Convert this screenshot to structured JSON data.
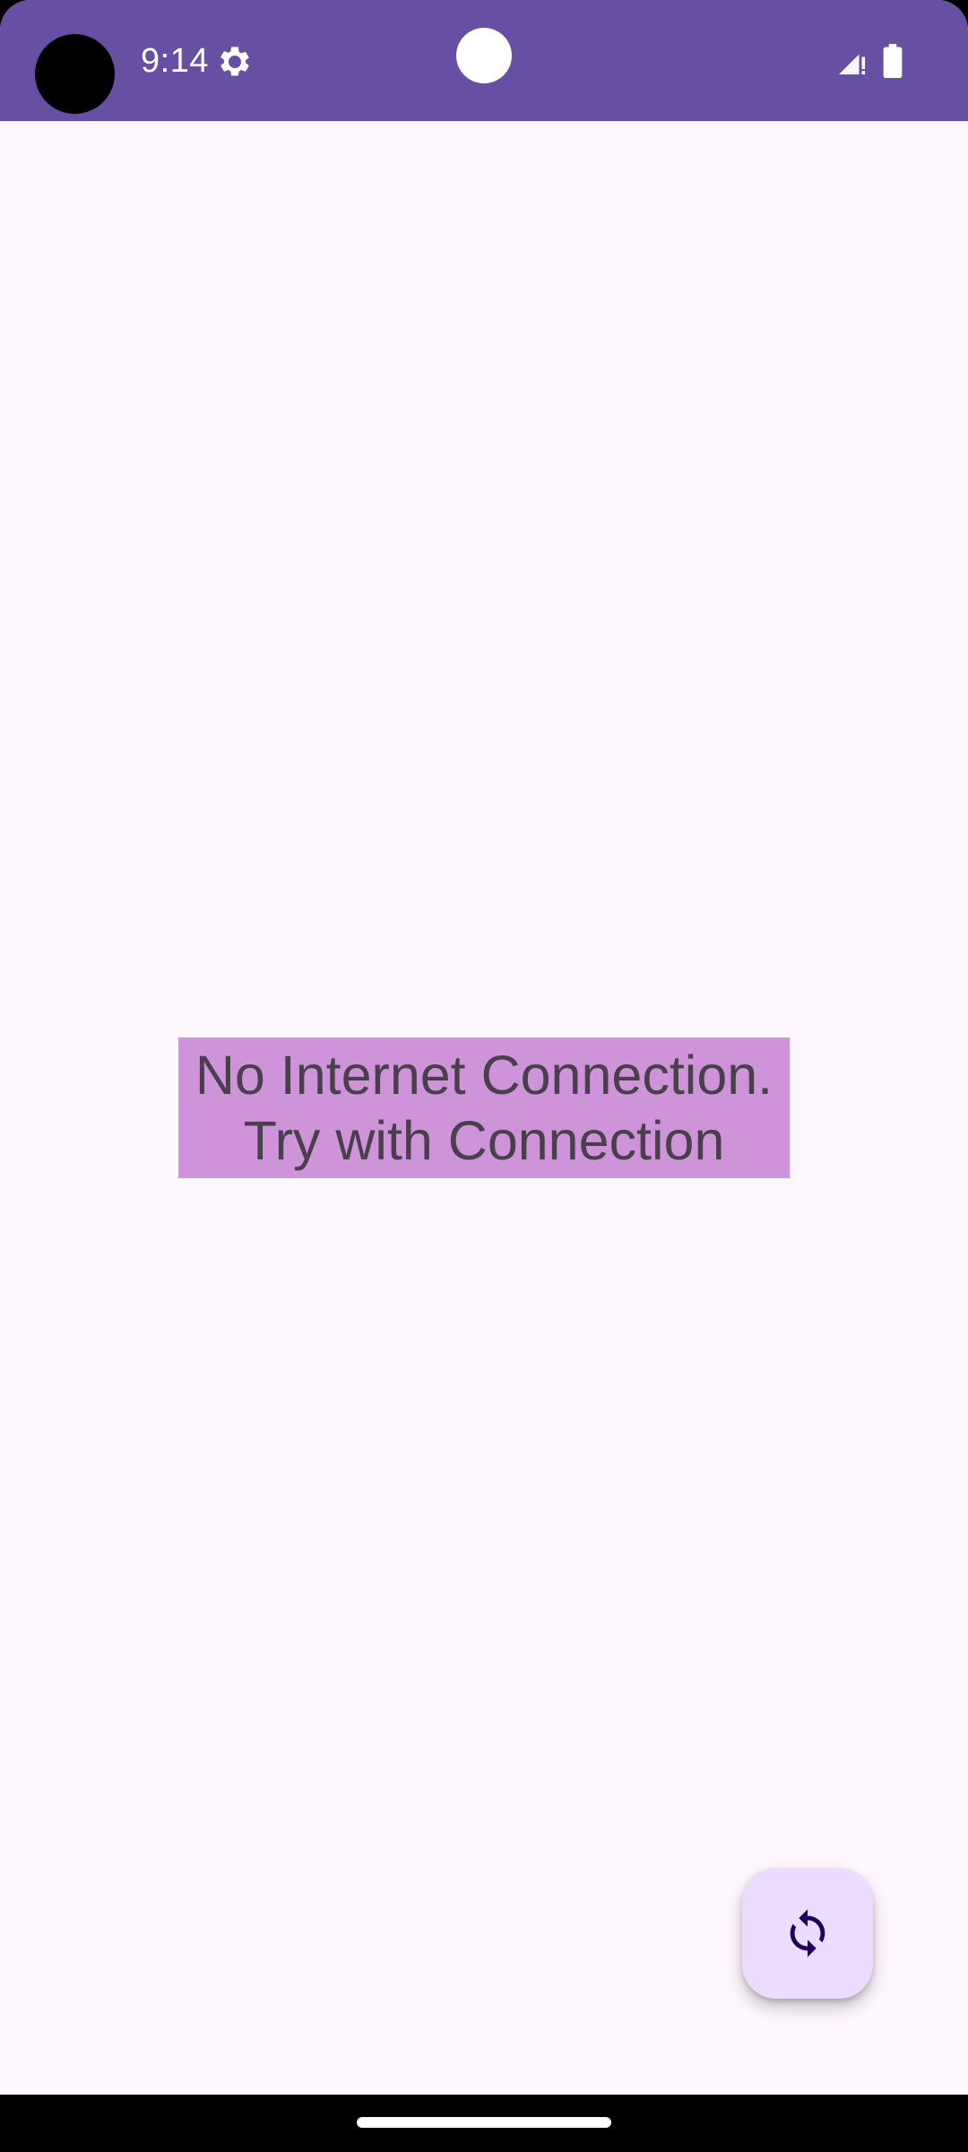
{
  "status_bar": {
    "time": "9:14",
    "icons": [
      "settings-icon",
      "signal-icon",
      "battery-icon"
    ],
    "background_color": "#6750A4"
  },
  "main": {
    "message_line1": "No Internet Connection.",
    "message_line2": "Try with Connection",
    "message_background": "#CE93D8"
  },
  "fab": {
    "icon": "refresh-icon",
    "background_color": "#EADDFF"
  },
  "navigation": {
    "handle": "home-gesture-bar"
  }
}
